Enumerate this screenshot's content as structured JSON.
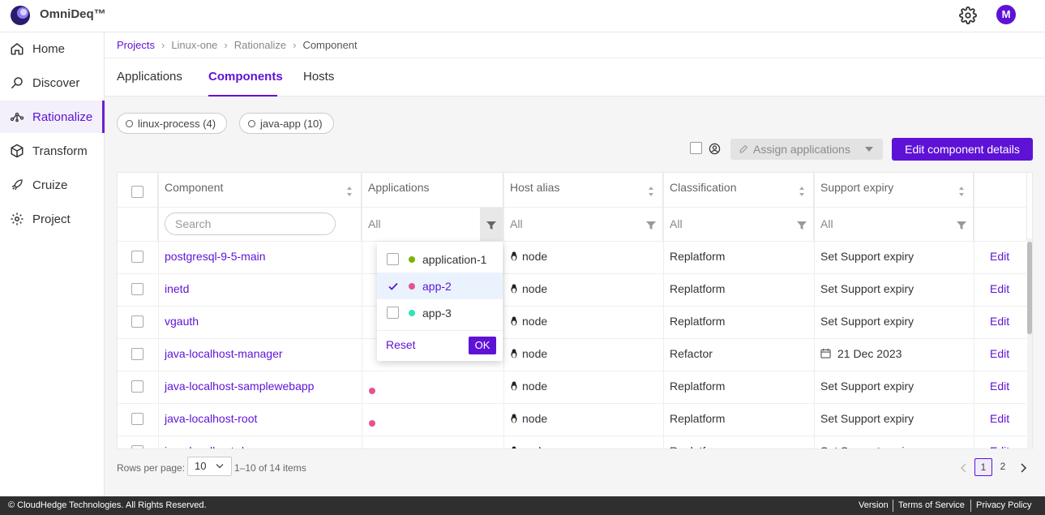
{
  "app": {
    "name": "OmniDeq™"
  },
  "user": {
    "initial": "M"
  },
  "sidebar": {
    "items": [
      {
        "label": "Home"
      },
      {
        "label": "Discover"
      },
      {
        "label": "Rationalize"
      },
      {
        "label": "Transform"
      },
      {
        "label": "Cruize"
      },
      {
        "label": "Project"
      }
    ]
  },
  "breadcrumb": [
    "Projects",
    "Linux-one",
    "Rationalize",
    "Component"
  ],
  "tabs": [
    "Applications",
    "Components",
    "Hosts"
  ],
  "chips": [
    {
      "label": "linux-process",
      "count": "(4)"
    },
    {
      "label": "java-app",
      "count": "(10)"
    }
  ],
  "toolbar": {
    "assign_label": "Assign applications",
    "edit_details_label": "Edit component details"
  },
  "table": {
    "columns": [
      "Component",
      "Applications",
      "Host alias",
      "Classification",
      "Support expiry"
    ],
    "search_placeholder": "Search",
    "filter_all": "All",
    "rows": [
      {
        "component": "postgresql-9-5-main",
        "host": "node",
        "classification": "Replatform",
        "expiry": "Set Support expiry",
        "edit": "Edit",
        "app_dot": ""
      },
      {
        "component": "inetd",
        "host": "node",
        "classification": "Replatform",
        "expiry": "Set Support expiry",
        "edit": "Edit",
        "app_dot": ""
      },
      {
        "component": "vgauth",
        "host": "node",
        "classification": "Replatform",
        "expiry": "Set Support expiry",
        "edit": "Edit",
        "app_dot": ""
      },
      {
        "component": "java-localhost-manager",
        "host": "node",
        "classification": "Refactor",
        "expiry": "21 Dec 2023",
        "edit": "Edit",
        "app_dot": ""
      },
      {
        "component": "java-localhost-samplewebapp",
        "host": "node",
        "classification": "Replatform",
        "expiry": "Set Support expiry",
        "edit": "Edit",
        "app_dot": "#e8528e"
      },
      {
        "component": "java-localhost-root",
        "host": "node",
        "classification": "Replatform",
        "expiry": "Set Support expiry",
        "edit": "Edit",
        "app_dot": "#e8528e"
      },
      {
        "component": "java-localhost-docs",
        "host": "node",
        "classification": "Replatform",
        "expiry": "Set Support expiry",
        "edit": "Edit",
        "app_dot": ""
      }
    ]
  },
  "app_filter": {
    "options": [
      {
        "label": "application-1",
        "color": "#7cb305",
        "checked": false
      },
      {
        "label": "app-2",
        "color": "#e8528e",
        "checked": true
      },
      {
        "label": "app-3",
        "color": "#2ee6b4",
        "checked": false
      }
    ],
    "reset_label": "Reset",
    "ok_label": "OK"
  },
  "pagination": {
    "rows_per_page_label": "Rows per page:",
    "rows_per_page": "10",
    "range_text": "1–10 of 14 items",
    "pages": [
      "1",
      "2"
    ],
    "current": "1"
  },
  "footer": {
    "copyright": "© CloudHedge Technologies. All Rights Reserved.",
    "links": [
      "Version",
      "Terms of Service",
      "Privacy Policy"
    ]
  },
  "colors": {
    "accent": "#5e12d6",
    "footer_bg": "#2f2f2f"
  }
}
